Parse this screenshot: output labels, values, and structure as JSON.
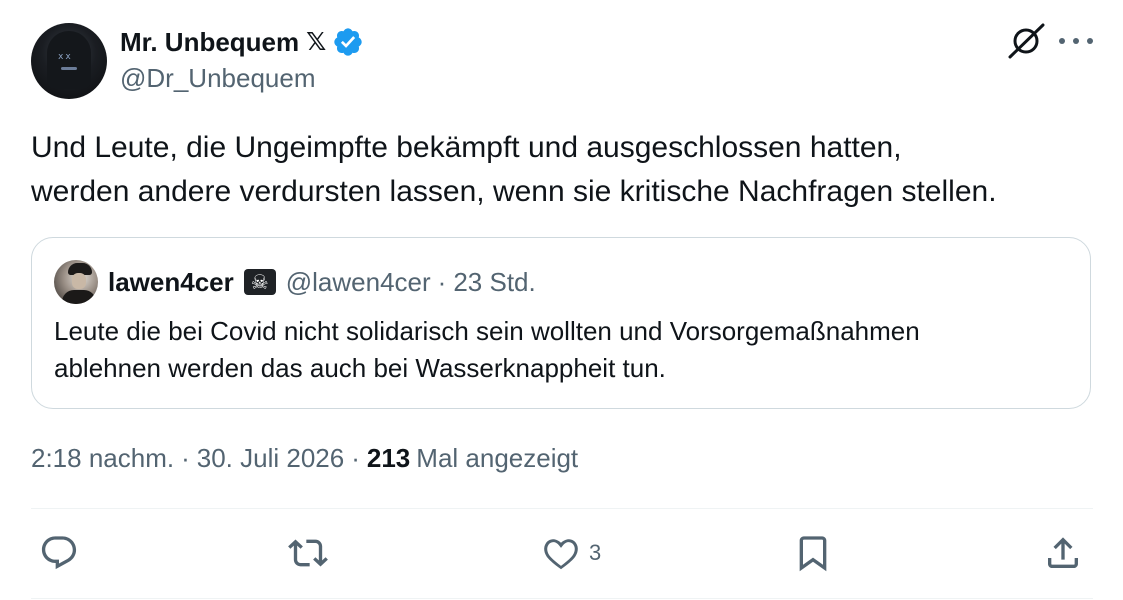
{
  "author": {
    "display_name": "Mr. Unbequem",
    "badge": "𝕏",
    "handle": "@Dr_Unbequem"
  },
  "tweet": {
    "text": "Und Leute, die Ungeimpfte bekämpft und ausgeschlossen hatten,\nwerden andere verdursten lassen, wenn sie kritische Nachfragen stellen."
  },
  "quote": {
    "name": "lawen4cer",
    "emoji": "☠",
    "handle": "@lawen4cer",
    "separator": "·",
    "time": "23 Std.",
    "text": "Leute die bei Covid nicht solidarisch sein wollten und Vorsorgemaßnahmen\nablehnen werden das auch bei Wasserknappheit tun."
  },
  "meta": {
    "time": "2:18 nachm.",
    "sep1": "·",
    "date": "30. Juli 2026",
    "sep2": "·",
    "views_count": "213",
    "views_label": "Mal angezeigt"
  },
  "actions": {
    "like_count": "3"
  },
  "colors": {
    "primary_text": "#0f1419",
    "secondary_text": "#536471",
    "verified_blue": "#1d9bf0",
    "border": "#cfd9de",
    "divider": "#eff3f4"
  },
  "icons": {
    "verified": "verified-badge-icon",
    "grok": "grok-icon",
    "more": "more-icon",
    "reply": "reply-icon",
    "repost": "repost-icon",
    "like": "like-icon",
    "bookmark": "bookmark-icon",
    "share": "share-icon"
  }
}
